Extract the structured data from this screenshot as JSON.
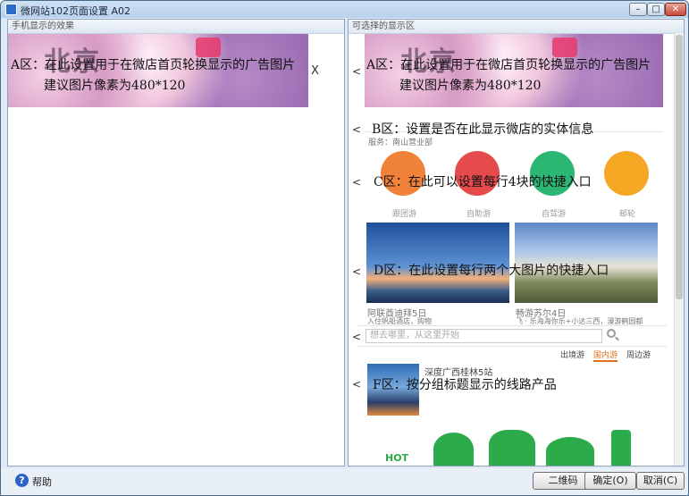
{
  "window": {
    "title": "微网站102页面设置 A02",
    "controls": {
      "minimize": "–",
      "maximize": "□",
      "close": "✕"
    }
  },
  "left_panel": {
    "header": "手机显示的效果",
    "banner_art": "北京",
    "zone_a": {
      "line1": "A区：在此设置用于在微店首页轮换显示的广告图片",
      "line2": "建议图片像素为480*120"
    },
    "remove_label": "X"
  },
  "right_panel": {
    "header": "可选择的显示区",
    "arrow": "<",
    "zone_a": {
      "line1": "A区：在此设置用于在微店首页轮换显示的广告图片",
      "line2": "建议图片像素为480*120"
    },
    "zone_b": {
      "label": "B区：设置是否在此显示微店的实体信息",
      "sub": "服务：南山营业部"
    },
    "zone_c": {
      "label": "C区：在此可以设置每行4块的快捷入口",
      "items": [
        "跟团游",
        "自助游",
        "自驾游",
        "邮轮"
      ]
    },
    "zone_d": {
      "label": "D区：在此设置每行两个大图片的快捷入口",
      "left_caption": "阿联酋迪拜5日",
      "left_sub": "入住帆船酒店，购物",
      "right_caption": "畅游苏尔4日",
      "right_sub": "飞 · 乐海海你乐+小达三西，漫游鹤园都"
    },
    "search": {
      "placeholder": "想去哪里，从这里开始"
    },
    "tabs": [
      "出境游",
      "国内游",
      "周边游"
    ],
    "active_tab": "国内游",
    "zone_f": {
      "label": "F区：按分组标题显示的线路产品",
      "product_title": "深度广西桂林5站"
    },
    "bottom_art_text": "HOT"
  },
  "bottom_bar": {
    "help": "帮助",
    "help_icon_glyph": "?",
    "qr_button": "二维码",
    "ok_button": "确定(O)",
    "cancel_button": "取消(C)"
  },
  "colors": {
    "circle1": "#f0823a",
    "circle2": "#e54b4b",
    "circle3": "#2bb673",
    "circle4": "#f5a623",
    "green_art": "#2bab4a"
  }
}
